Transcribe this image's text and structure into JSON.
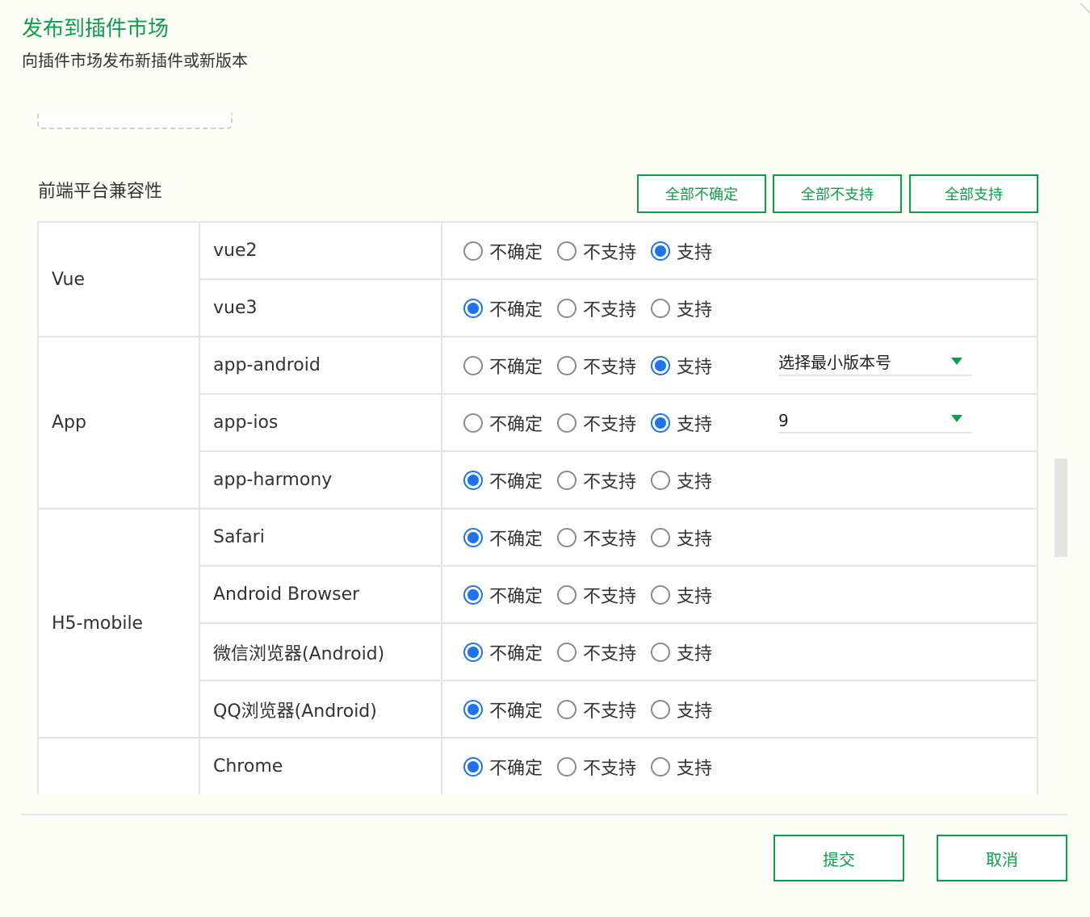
{
  "dialog": {
    "title": "发布到插件市场",
    "subtitle": "向插件市场发布新插件或新版本"
  },
  "section": {
    "title": "前端平台兼容性",
    "bulk_buttons": [
      "全部不确定",
      "全部不支持",
      "全部支持"
    ]
  },
  "options": [
    "不确定",
    "不支持",
    "支持"
  ],
  "groups": [
    {
      "name": "Vue",
      "platforms": [
        {
          "name": "vue2",
          "selected": 2
        },
        {
          "name": "vue3",
          "selected": 0
        }
      ]
    },
    {
      "name": "App",
      "platforms": [
        {
          "name": "app-android",
          "selected": 2,
          "version": "选择最小版本号"
        },
        {
          "name": "app-ios",
          "selected": 2,
          "version": "9"
        },
        {
          "name": "app-harmony",
          "selected": 0
        }
      ]
    },
    {
      "name": "H5-mobile",
      "platforms": [
        {
          "name": "Safari",
          "selected": 0
        },
        {
          "name": "Android Browser",
          "selected": 0
        },
        {
          "name": "微信浏览器(Android)",
          "selected": 0
        },
        {
          "name": "QQ浏览器(Android)",
          "selected": 0
        }
      ]
    },
    {
      "name": "",
      "platforms": [
        {
          "name": "Chrome",
          "selected": 0
        }
      ]
    }
  ],
  "footer": {
    "submit": "提交",
    "cancel": "取消"
  },
  "colors": {
    "accent": "#0d9e4a",
    "radio_selected": "#1e74f0"
  }
}
